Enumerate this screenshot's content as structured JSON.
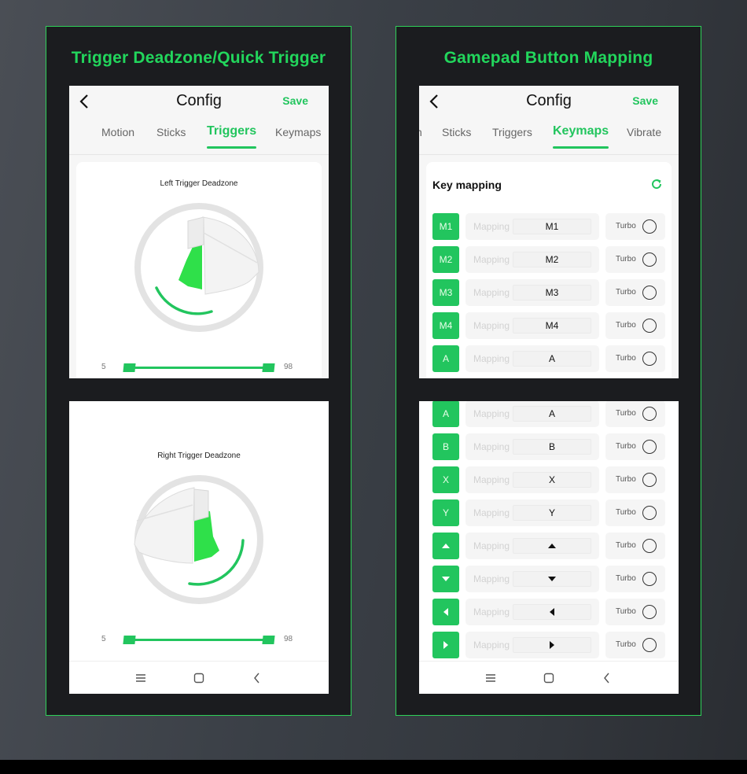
{
  "left_panel": {
    "title": "Trigger Deadzone/Quick Trigger",
    "header": {
      "title": "Config",
      "save_label": "Save"
    },
    "tabs": [
      {
        "label": "Motion",
        "active": false
      },
      {
        "label": "Sticks",
        "active": false
      },
      {
        "label": "Triggers",
        "active": true
      },
      {
        "label": "Keymaps",
        "active": false
      }
    ],
    "left_trigger": {
      "title": "Left Trigger Deadzone",
      "min_label": "5",
      "max_label": "98",
      "range": [
        5,
        98
      ]
    },
    "right_trigger": {
      "title": "Right Trigger Deadzone",
      "min_label": "5",
      "max_label": "98",
      "range": [
        5,
        98
      ]
    },
    "nav_icons": [
      "menu-icon",
      "home-icon",
      "back-icon"
    ]
  },
  "right_panel": {
    "title": "Gamepad Button Mapping",
    "header": {
      "title": "Config",
      "save_label": "Save"
    },
    "tabs": [
      {
        "label": "n",
        "active": false
      },
      {
        "label": "Sticks",
        "active": false
      },
      {
        "label": "Triggers",
        "active": false
      },
      {
        "label": "Keymaps",
        "active": true
      },
      {
        "label": "Vibrate",
        "active": false
      }
    ],
    "key_mapping_title": "Key mapping",
    "mapping_placeholder": "Mapping",
    "turbo_label": "Turbo",
    "rows_top": [
      {
        "key": "M1",
        "mapping": "M1",
        "turbo": false
      },
      {
        "key": "M2",
        "mapping": "M2",
        "turbo": false
      },
      {
        "key": "M3",
        "mapping": "M3",
        "turbo": false
      },
      {
        "key": "M4",
        "mapping": "M4",
        "turbo": false
      },
      {
        "key": "A",
        "mapping": "A",
        "turbo": false
      }
    ],
    "rows_bottom": [
      {
        "key": "A",
        "mapping": "A",
        "turbo": false
      },
      {
        "key": "B",
        "mapping": "B",
        "turbo": false
      },
      {
        "key": "X",
        "mapping": "X",
        "turbo": false
      },
      {
        "key": "Y",
        "mapping": "Y",
        "turbo": false
      },
      {
        "key": "dpad-up",
        "mapping": "dpad-up",
        "turbo": false
      },
      {
        "key": "dpad-down",
        "mapping": "dpad-down",
        "turbo": false
      },
      {
        "key": "dpad-left",
        "mapping": "dpad-left",
        "turbo": false
      },
      {
        "key": "dpad-right",
        "mapping": "dpad-right",
        "turbo": false
      }
    ]
  },
  "colors": {
    "accent": "#22c55e",
    "title_green": "#22d65c",
    "panel_bg": "#1b1c1f",
    "border": "#2ed158"
  }
}
